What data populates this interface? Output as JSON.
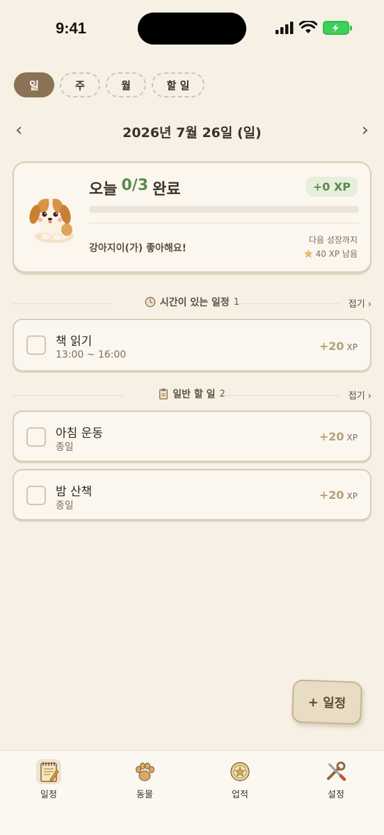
{
  "status": {
    "time": "9:41"
  },
  "tabs": [
    {
      "label": "일",
      "active": true
    },
    {
      "label": "주",
      "active": false
    },
    {
      "label": "월",
      "active": false
    },
    {
      "label": "할 일",
      "active": false
    }
  ],
  "date_nav": {
    "title": "2026년 7월 26일 (일)",
    "prev": "‹",
    "next": "›"
  },
  "summary": {
    "title_prefix": "오늘",
    "count": "0/3",
    "title_suffix": "완료",
    "xp_badge": "+0 XP",
    "progress": 0,
    "message": "강아지이(가) 좋아해요!",
    "next_label": "다음 성장까지",
    "xp_left": "40 XP 남음"
  },
  "sections": {
    "timed": {
      "title": "시간이 있는 일정",
      "count": "1",
      "collapse": "접기 ›"
    },
    "general": {
      "title": "일반 할 일",
      "count": "2",
      "collapse": "접기 ›"
    }
  },
  "tasks": {
    "timed": [
      {
        "title": "책 읽기",
        "sub": "13:00 ~ 16:00",
        "xp": "+20",
        "xp_unit": "XP"
      }
    ],
    "general": [
      {
        "title": "아침 운동",
        "sub": "종일",
        "xp": "+20",
        "xp_unit": "XP"
      },
      {
        "title": "밤 산책",
        "sub": "종일",
        "xp": "+20",
        "xp_unit": "XP"
      }
    ]
  },
  "fab": {
    "label": "+ 일정"
  },
  "tabbar": [
    {
      "label": "일정",
      "icon": "notepad-icon",
      "active": true
    },
    {
      "label": "동물",
      "icon": "paw-icon",
      "active": false
    },
    {
      "label": "업적",
      "icon": "medal-icon",
      "active": false
    },
    {
      "label": "설정",
      "icon": "tools-icon",
      "active": false
    }
  ],
  "colors": {
    "accent": "#8b7254",
    "success": "#5c8a4c",
    "background": "#f6f0e5"
  }
}
